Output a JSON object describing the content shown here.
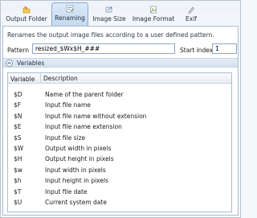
{
  "tabs": [
    {
      "label": "Output Folder",
      "icon": "folder-icon",
      "active": false
    },
    {
      "label": "Renaming",
      "icon": "rename-icon",
      "active": true
    },
    {
      "label": "Image Size",
      "icon": "resize-icon",
      "active": false
    },
    {
      "label": "Image Format",
      "icon": "format-icon",
      "active": false
    },
    {
      "label": "Exif",
      "icon": "exif-icon",
      "active": false
    }
  ],
  "renaming": {
    "description": "Renames the output image files according to a user defined pattern.",
    "pattern_label": "Pattern",
    "pattern_value": "resized_$Wx$H_###",
    "start_index_label": "Start index",
    "start_index_value": "1"
  },
  "variables": {
    "title": "Variables",
    "columns": [
      "Variable",
      "Description"
    ],
    "rows": [
      [
        "$D",
        "Name of the parent folder"
      ],
      [
        "$F",
        "Input file name"
      ],
      [
        "$N",
        "Input file name without extension"
      ],
      [
        "$E",
        "Input file name extension"
      ],
      [
        "$S",
        "Input file size"
      ],
      [
        "$W",
        "Output width in pixels"
      ],
      [
        "$H",
        "Output height in pixels"
      ],
      [
        "$w",
        "Input width in pixels"
      ],
      [
        "$h",
        "Input height in pixels"
      ],
      [
        "$T",
        "Input file date"
      ],
      [
        "$U",
        "Current system date"
      ]
    ]
  },
  "colors": {
    "accent": "#c3d8ef",
    "border": "#a9bcd4"
  }
}
